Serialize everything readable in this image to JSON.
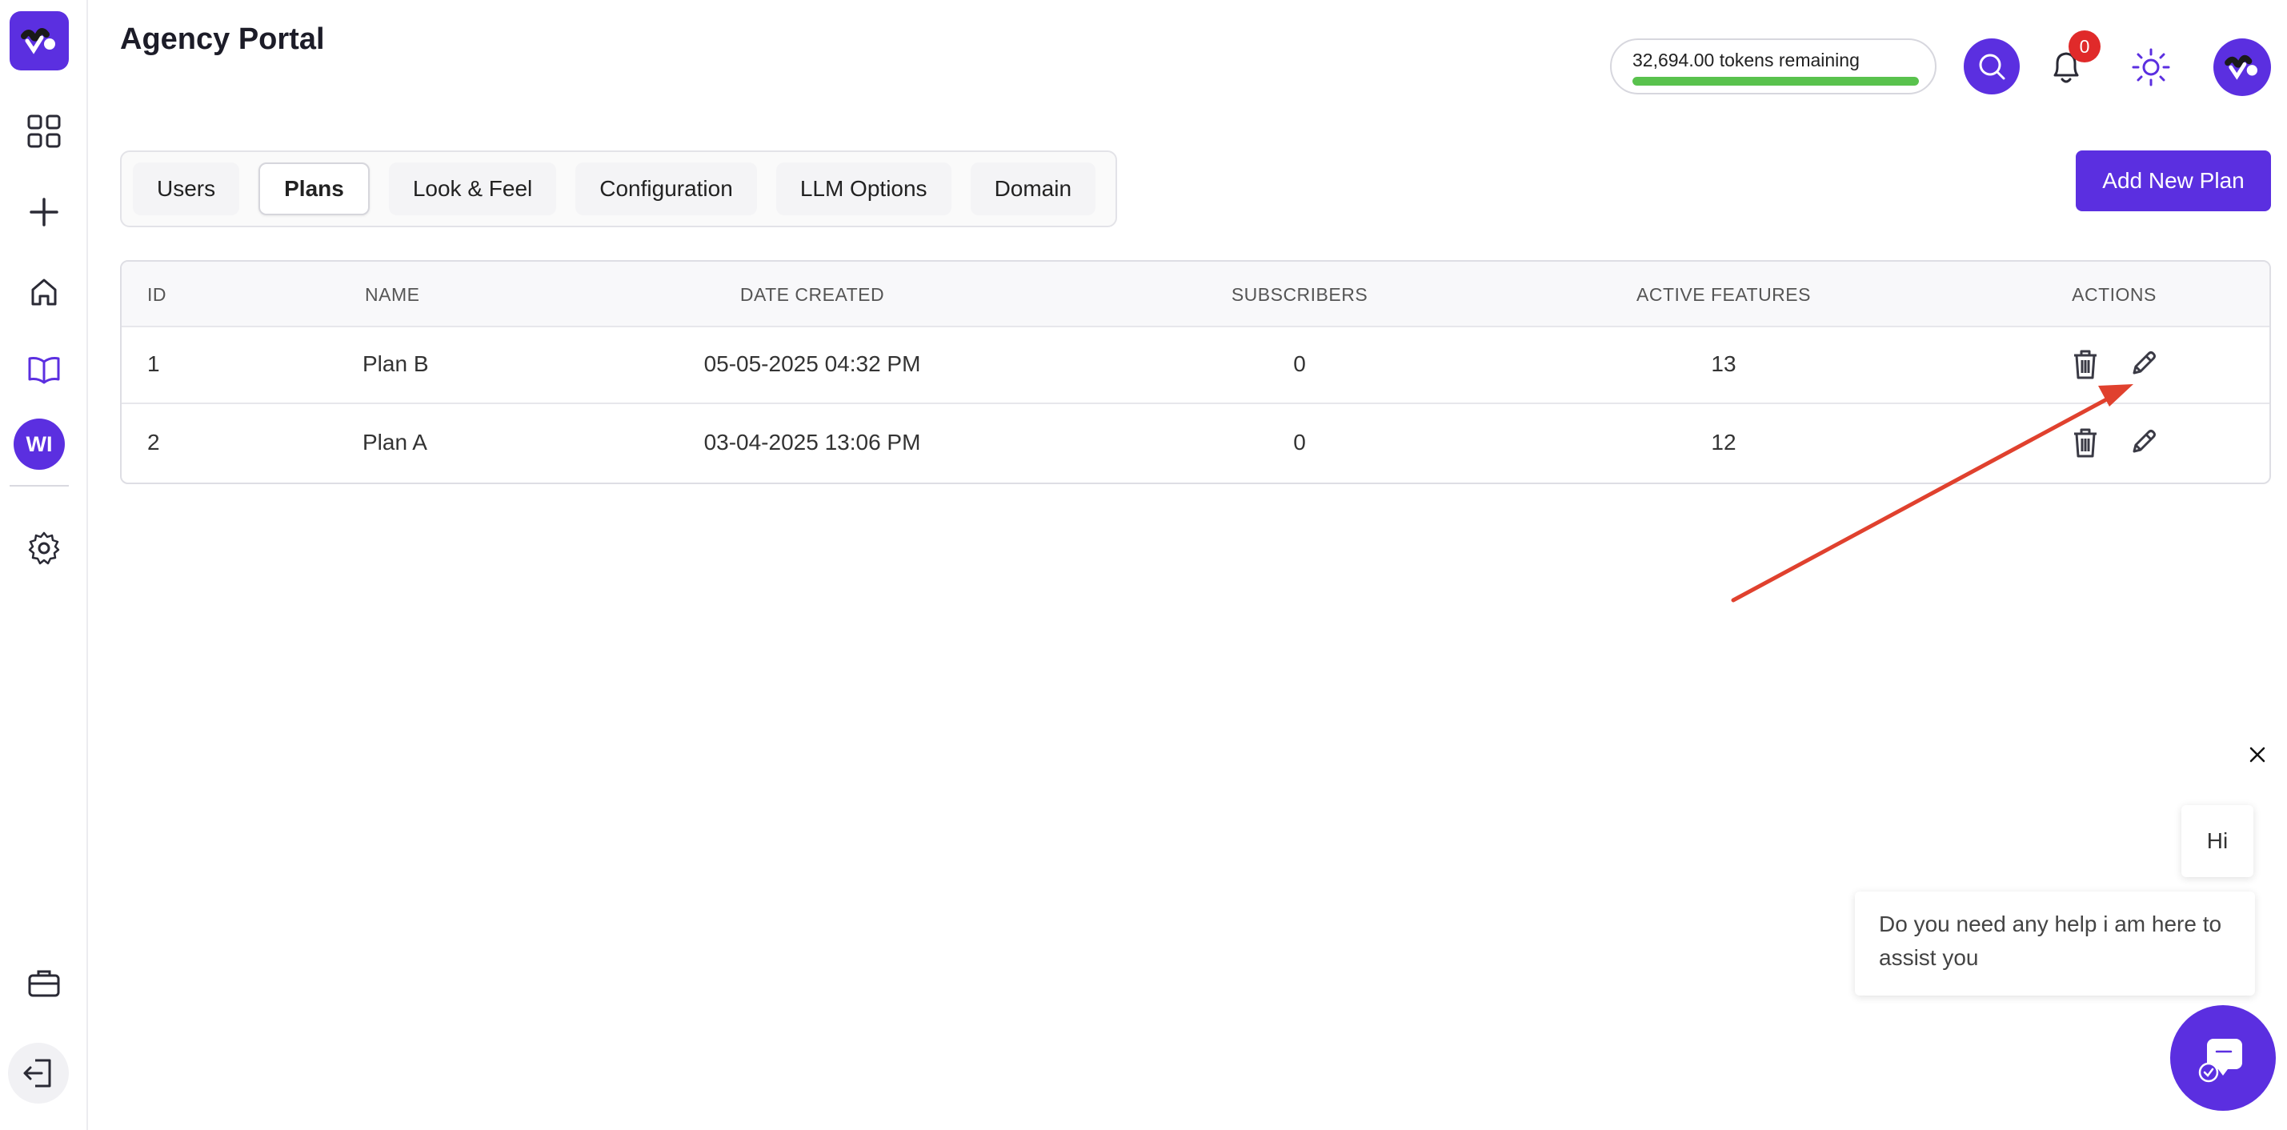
{
  "app": {
    "title": "Agency Portal"
  },
  "header": {
    "tokens_label": "32,694.00 tokens remaining",
    "tokens_progress": 1.0,
    "notification_count": "0"
  },
  "sidebar": {
    "items": [
      {
        "name": "dashboard",
        "icon": "grid-icon"
      },
      {
        "name": "add",
        "icon": "plus-icon"
      },
      {
        "name": "home",
        "icon": "home-icon"
      },
      {
        "name": "library",
        "icon": "book-icon",
        "active": true
      },
      {
        "name": "workspace",
        "label": "WI"
      },
      {
        "name": "settings",
        "icon": "gear-icon"
      },
      {
        "name": "briefcase",
        "icon": "briefcase-icon"
      },
      {
        "name": "logout",
        "icon": "logout-icon"
      }
    ]
  },
  "tabs": [
    {
      "label": "Users",
      "active": false
    },
    {
      "label": "Plans",
      "active": true
    },
    {
      "label": "Look & Feel",
      "active": false
    },
    {
      "label": "Configuration",
      "active": false
    },
    {
      "label": "LLM Options",
      "active": false
    },
    {
      "label": "Domain",
      "active": false
    }
  ],
  "add_plan_label": "Add New Plan",
  "table": {
    "columns": [
      "ID",
      "NAME",
      "DATE CREATED",
      "SUBSCRIBERS",
      "ACTIVE FEATURES",
      "ACTIONS"
    ],
    "rows": [
      {
        "id": "1",
        "name": "Plan B",
        "date": "05-05-2025 04:32 PM",
        "subscribers": "0",
        "features": "13"
      },
      {
        "id": "2",
        "name": "Plan A",
        "date": "03-04-2025 13:06 PM",
        "subscribers": "0",
        "features": "12"
      }
    ]
  },
  "chat": {
    "hi": "Hi",
    "help": "Do you need any help i am here to assist you"
  },
  "colors": {
    "accent": "#5b2fe0",
    "progress": "#59c24d",
    "badge": "#e02a2a",
    "annotation_arrow": "#e0412e"
  }
}
